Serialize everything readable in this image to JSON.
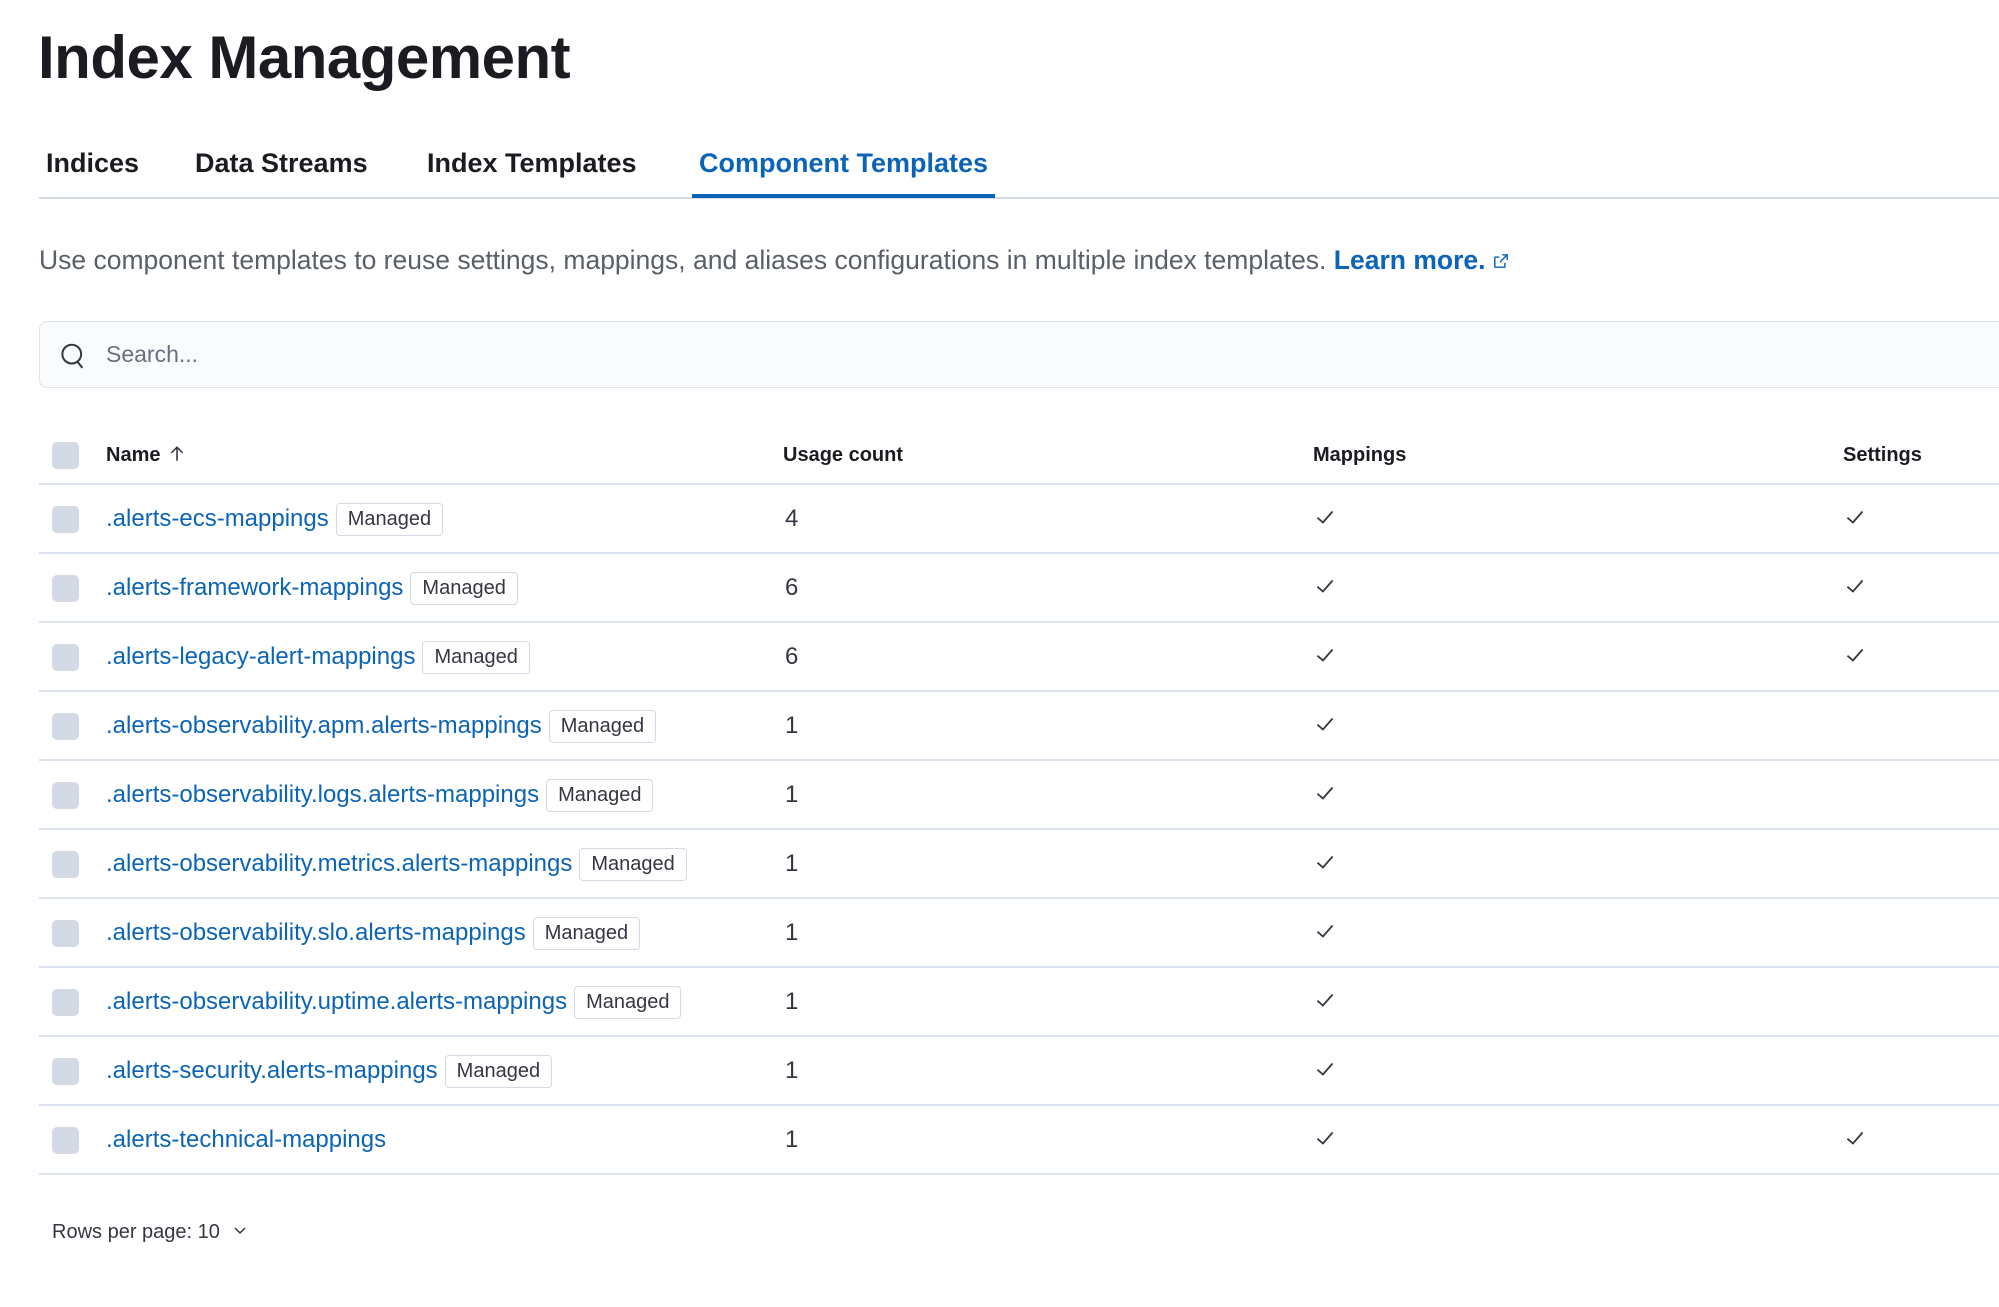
{
  "page": {
    "title": "Index Management"
  },
  "tabs": [
    {
      "label": "Indices",
      "active": false
    },
    {
      "label": "Data Streams",
      "active": false
    },
    {
      "label": "Index Templates",
      "active": false
    },
    {
      "label": "Component Templates",
      "active": true
    }
  ],
  "description": {
    "text": "Use component templates to reuse settings, mappings, and aliases configurations in multiple index templates. ",
    "link_label": "Learn more."
  },
  "search": {
    "placeholder": "Search...",
    "value": ""
  },
  "table": {
    "columns": {
      "name": "Name",
      "usage_count": "Usage count",
      "mappings": "Mappings",
      "settings": "Settings"
    },
    "sort": {
      "column": "Name",
      "direction": "ascending"
    },
    "rows": [
      {
        "name": ".alerts-ecs-mappings",
        "badge": "Managed",
        "usage_count": "4",
        "mappings": true,
        "settings": true
      },
      {
        "name": ".alerts-framework-mappings",
        "badge": "Managed",
        "usage_count": "6",
        "mappings": true,
        "settings": true
      },
      {
        "name": ".alerts-legacy-alert-mappings",
        "badge": "Managed",
        "usage_count": "6",
        "mappings": true,
        "settings": true
      },
      {
        "name": ".alerts-observability.apm.alerts-mappings",
        "badge": "Managed",
        "usage_count": "1",
        "mappings": true,
        "settings": false
      },
      {
        "name": ".alerts-observability.logs.alerts-mappings",
        "badge": "Managed",
        "usage_count": "1",
        "mappings": true,
        "settings": false
      },
      {
        "name": ".alerts-observability.metrics.alerts-mappings",
        "badge": "Managed",
        "usage_count": "1",
        "mappings": true,
        "settings": false
      },
      {
        "name": ".alerts-observability.slo.alerts-mappings",
        "badge": "Managed",
        "usage_count": "1",
        "mappings": true,
        "settings": false
      },
      {
        "name": ".alerts-observability.uptime.alerts-mappings",
        "badge": "Managed",
        "usage_count": "1",
        "mappings": true,
        "settings": false
      },
      {
        "name": ".alerts-security.alerts-mappings",
        "badge": "Managed",
        "usage_count": "1",
        "mappings": true,
        "settings": false
      },
      {
        "name": ".alerts-technical-mappings",
        "badge": null,
        "usage_count": "1",
        "mappings": true,
        "settings": true
      }
    ]
  },
  "pagination": {
    "rows_per_page_label": "Rows per page: 10"
  },
  "colors": {
    "accent": "#0b64b8",
    "text": "#1a1c21",
    "muted": "#5a606b",
    "border": "#d3dae6"
  }
}
